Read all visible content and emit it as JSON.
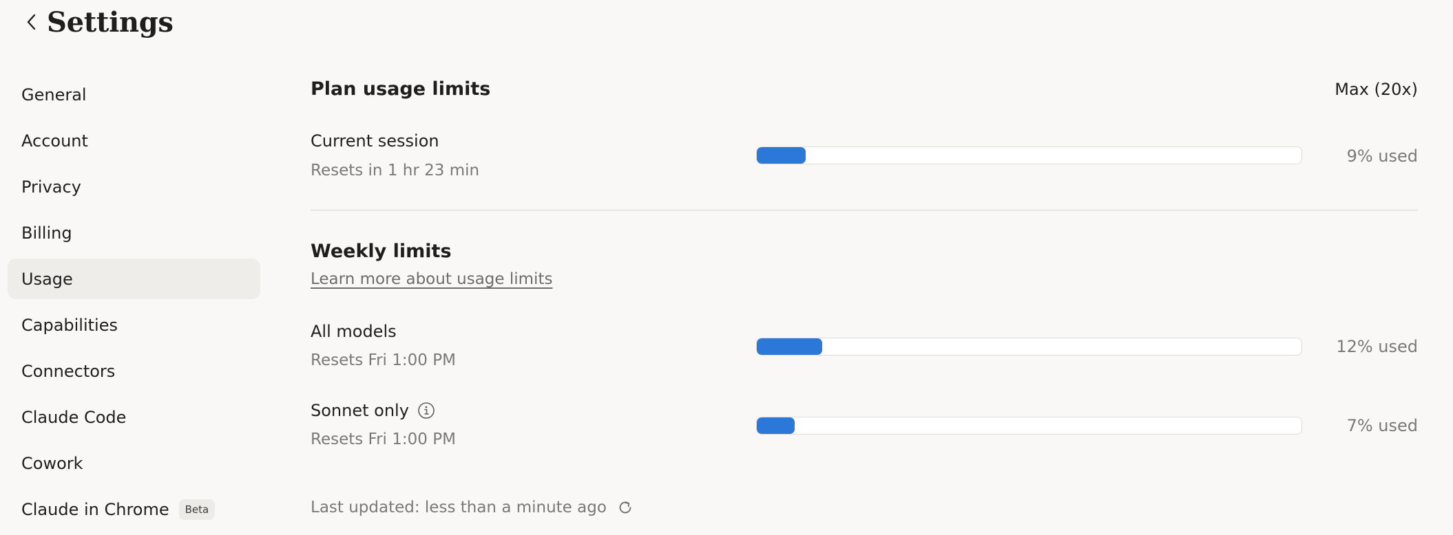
{
  "header": {
    "title": "Settings"
  },
  "sidebar": {
    "items": [
      {
        "label": "General"
      },
      {
        "label": "Account"
      },
      {
        "label": "Privacy"
      },
      {
        "label": "Billing"
      },
      {
        "label": "Usage",
        "active": true
      },
      {
        "label": "Capabilities"
      },
      {
        "label": "Connectors"
      },
      {
        "label": "Claude Code"
      },
      {
        "label": "Cowork"
      },
      {
        "label": "Claude in Chrome",
        "badge": "Beta"
      }
    ]
  },
  "plan": {
    "title": "Plan usage limits",
    "name": "Max (20x)",
    "current_session": {
      "label": "Current session",
      "reset": "Resets in 1 hr 23 min",
      "used_text": "9% used",
      "used_fraction": 0.09
    }
  },
  "weekly": {
    "title": "Weekly limits",
    "learn_more": "Learn more about usage limits",
    "all_models": {
      "label": "All models",
      "reset": "Resets Fri 1:00 PM",
      "used_text": "12% used",
      "used_fraction": 0.12
    },
    "sonnet_only": {
      "label": "Sonnet only",
      "reset": "Resets Fri 1:00 PM",
      "used_text": "7% used",
      "used_fraction": 0.07
    }
  },
  "footer": {
    "last_updated": "Last updated: less than a minute ago"
  },
  "colors": {
    "accent": "#2b78d8",
    "background": "#f9f8f6",
    "active_item": "#efedea"
  },
  "icons": {
    "back": "chevron-left-icon",
    "info": "info-icon",
    "refresh": "refresh-icon"
  }
}
